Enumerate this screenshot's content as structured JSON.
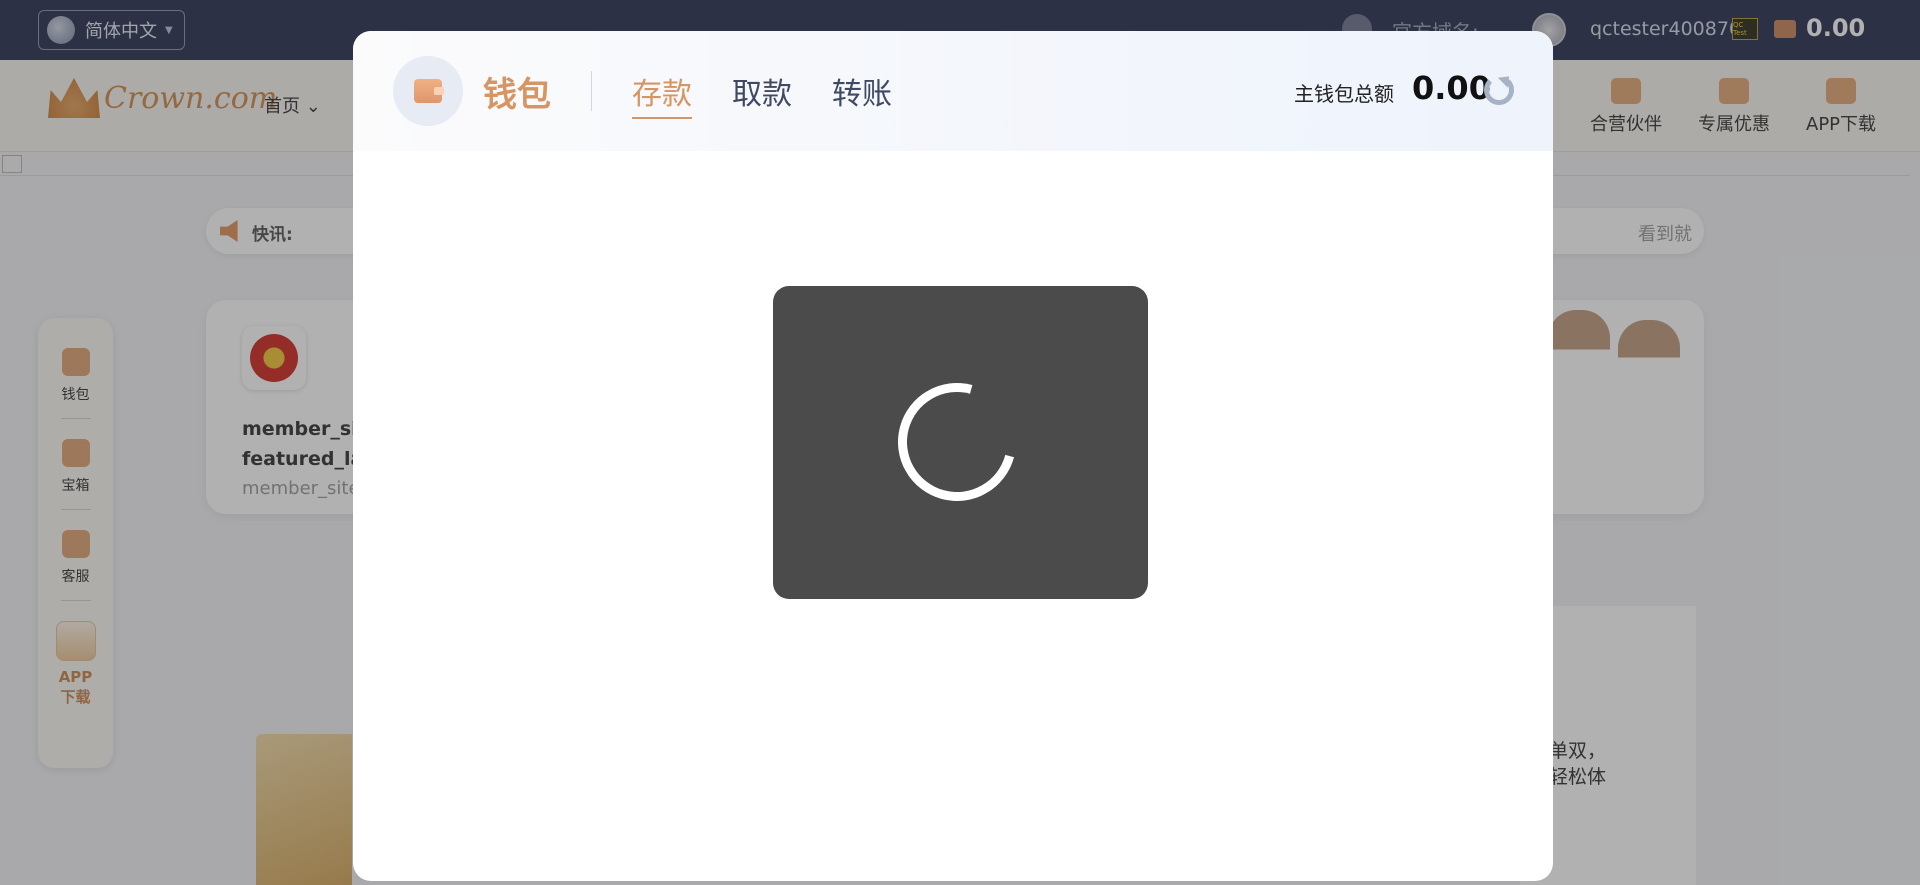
{
  "topbar": {
    "language": "简体中文",
    "domain_label": "官方域名:",
    "username": "qctester400870",
    "vip_badge": "QC Test",
    "balance": "0.00"
  },
  "nav": {
    "logo_text": "Crown.com",
    "home": "首页",
    "right_items": [
      {
        "label": "合营伙伴",
        "icon": "handshake-icon"
      },
      {
        "label": "专属优惠",
        "icon": "gift-icon"
      },
      {
        "label": "APP下载",
        "icon": "app-icon"
      }
    ]
  },
  "ticker": {
    "label": "快讯:",
    "text": "看到就"
  },
  "sidebar": {
    "items": [
      {
        "label": "钱包",
        "icon": "wallet-icon"
      },
      {
        "label": "宝箱",
        "icon": "treasure-icon"
      },
      {
        "label": "客服",
        "icon": "support-icon"
      }
    ],
    "app_label_1": "APP",
    "app_label_2": "下载"
  },
  "card": {
    "line1": "member_site",
    "line2": "featured_lab",
    "line3": "member_site"
  },
  "card2": {
    "line1": "胆单双，",
    "line2": "您轻松体"
  },
  "modal": {
    "title": "钱包",
    "tabs": [
      {
        "label": "存款",
        "active": true
      },
      {
        "label": "取款",
        "active": false
      },
      {
        "label": "转账",
        "active": false
      }
    ],
    "balance_label": "主钱包总额",
    "balance_value": "0.00",
    "accent_color": "#d69562"
  }
}
